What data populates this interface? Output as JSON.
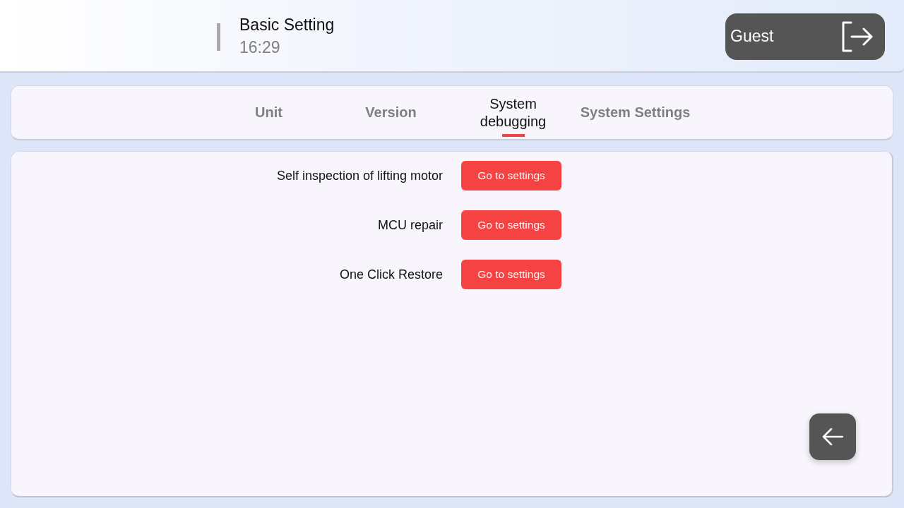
{
  "header": {
    "title": "Basic Setting",
    "time": "16:29",
    "user_button": {
      "label": "Guest"
    }
  },
  "tabs": [
    {
      "label": "Unit",
      "selected": false
    },
    {
      "label": "Version",
      "selected": false
    },
    {
      "label": "System debugging",
      "selected": true
    },
    {
      "label": "System Settings",
      "selected": false
    }
  ],
  "debug_items": [
    {
      "label": "Self inspection of lifting motor",
      "button": "Go to settings"
    },
    {
      "label": "MCU repair",
      "button": "Go to settings"
    },
    {
      "label": "One Click Restore",
      "button": "Go to settings"
    }
  ]
}
